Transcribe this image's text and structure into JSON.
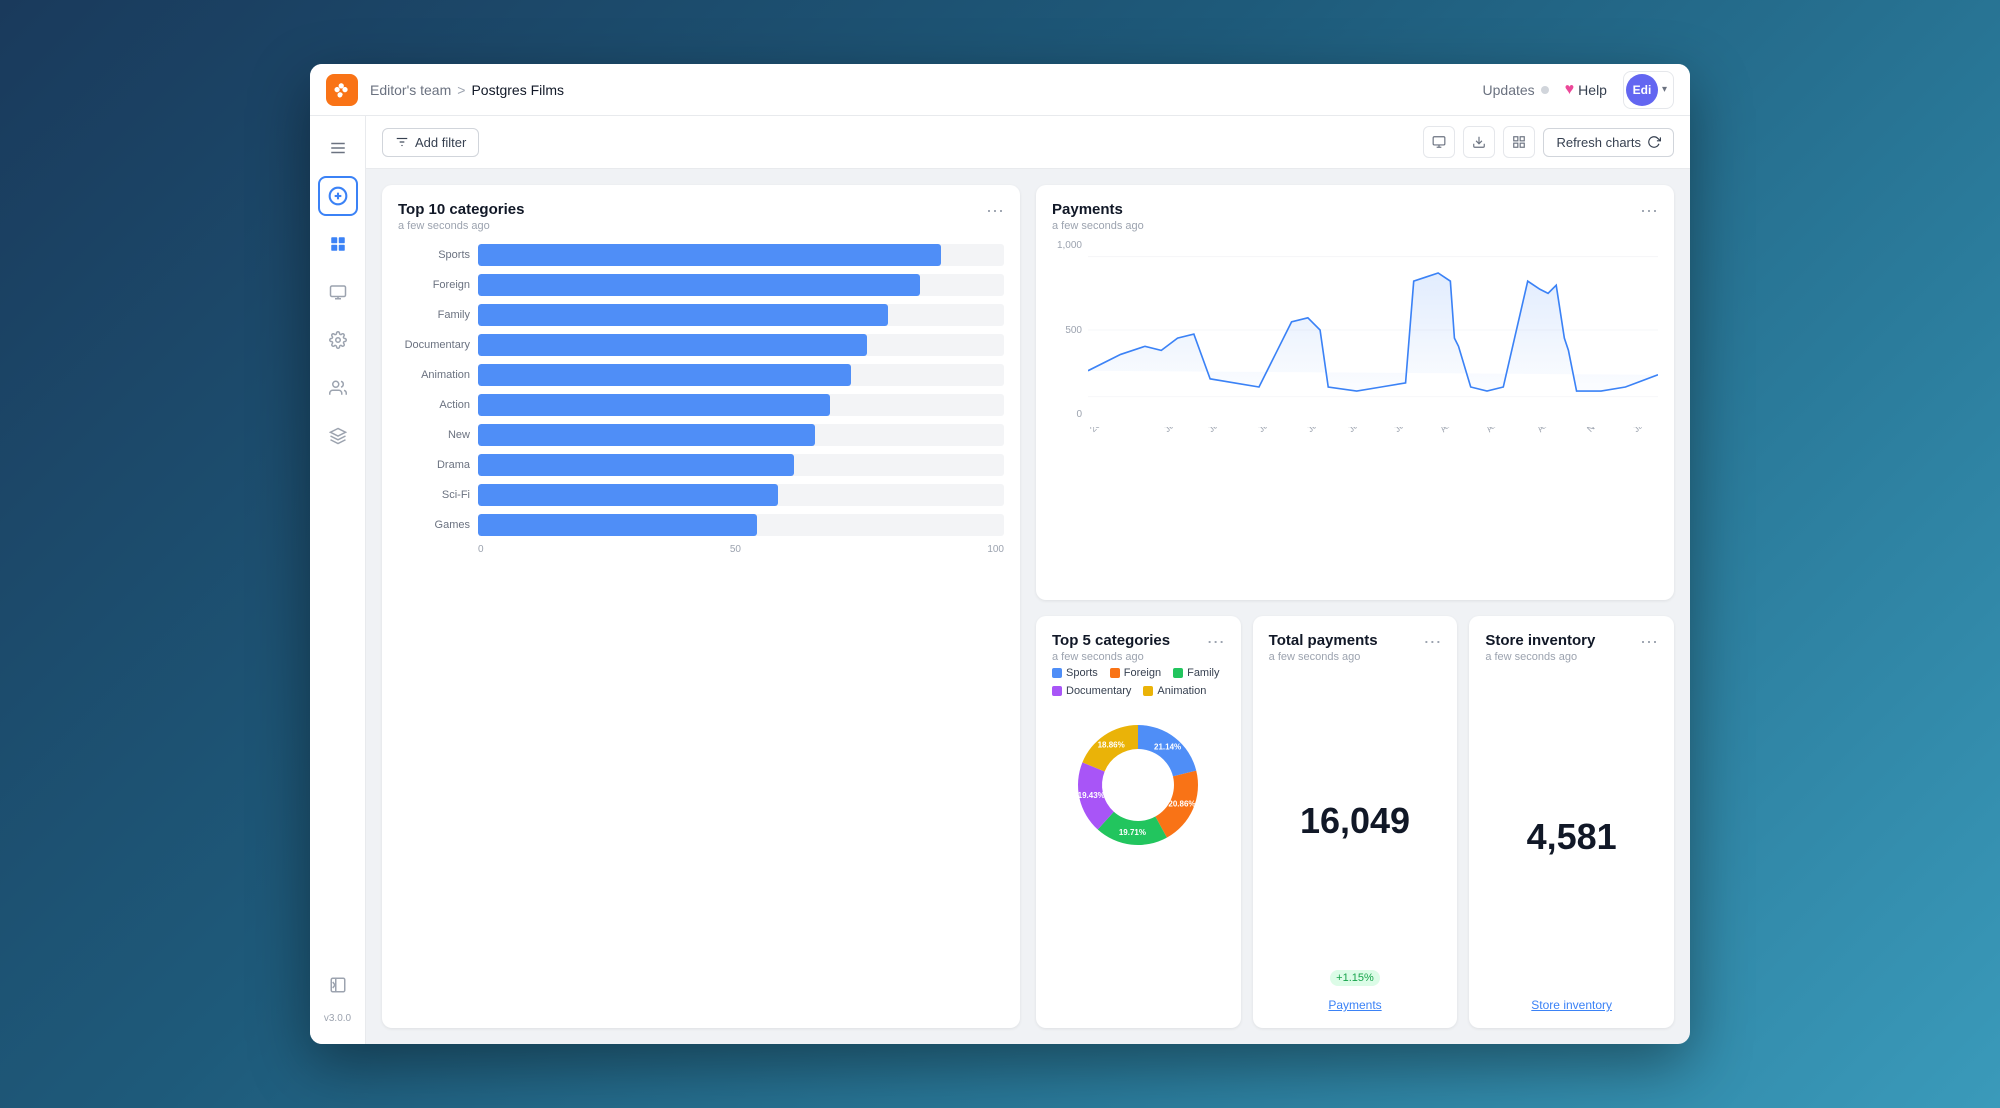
{
  "topbar": {
    "logo_icon": "🤚",
    "team": "Editor's team",
    "separator": ">",
    "project": "Postgres Films",
    "updates_label": "Updates",
    "help_label": "Help",
    "user_initials": "Edi",
    "user_chevron": "▾"
  },
  "toolbar": {
    "add_filter_label": "Add filter",
    "refresh_label": "Refresh charts"
  },
  "sidebar": {
    "version": "v3.0.0",
    "items": [
      {
        "id": "menu",
        "icon": "☰",
        "label": "Menu"
      },
      {
        "id": "add",
        "icon": "+",
        "label": "Add"
      },
      {
        "id": "dashboard",
        "icon": "⊞",
        "label": "Dashboard"
      },
      {
        "id": "display",
        "icon": "▭",
        "label": "Display"
      },
      {
        "id": "settings",
        "icon": "⚙",
        "label": "Settings"
      },
      {
        "id": "users",
        "icon": "👥",
        "label": "Users"
      },
      {
        "id": "integrations",
        "icon": "⊕",
        "label": "Integrations"
      },
      {
        "id": "collapse",
        "icon": "◧",
        "label": "Collapse"
      }
    ]
  },
  "top_categories_chart": {
    "title": "Top 10 categories",
    "subtitle": "a few seconds ago",
    "bars": [
      {
        "label": "Sports",
        "value": 100,
        "pct": 88
      },
      {
        "label": "Foreign",
        "value": 95,
        "pct": 84
      },
      {
        "label": "Family",
        "value": 88,
        "pct": 78
      },
      {
        "label": "Documentary",
        "value": 84,
        "pct": 74
      },
      {
        "label": "Animation",
        "value": 80,
        "pct": 71
      },
      {
        "label": "Action",
        "value": 76,
        "pct": 67
      },
      {
        "label": "New",
        "value": 72,
        "pct": 64
      },
      {
        "label": "Drama",
        "value": 68,
        "pct": 60
      },
      {
        "label": "Sci-Fi",
        "value": 64,
        "pct": 57
      },
      {
        "label": "Games",
        "value": 60,
        "pct": 53
      }
    ],
    "axis_labels": [
      "0",
      "50",
      "100"
    ]
  },
  "payments_chart": {
    "title": "Payments",
    "subtitle": "a few seconds ago",
    "y_labels": [
      "1,000",
      "500",
      "0"
    ],
    "x_labels": [
      "2005 May 24",
      "2005 Jun 3",
      "2005 Jun 13",
      "2005 Jun 23",
      "2005 Jul 3",
      "2005 Jul 13",
      "2005 Jul 23",
      "2005 Aug 2",
      "2005 Aug 12",
      "2005 Aug 22",
      "2005 Nov 3",
      "2006 Jan 22"
    ]
  },
  "top5_chart": {
    "title": "Top 5 categories",
    "subtitle": "a few seconds ago",
    "legend": [
      {
        "label": "Sports",
        "color": "#4f8ef7"
      },
      {
        "label": "Foreign",
        "color": "#f97316"
      },
      {
        "label": "Family",
        "color": "#22c55e"
      },
      {
        "label": "Documentary",
        "color": "#a855f7"
      },
      {
        "label": "Animation",
        "color": "#eab308"
      }
    ],
    "segments": [
      {
        "label": "21.14%",
        "value": 21.14,
        "color": "#4f8ef7"
      },
      {
        "label": "20.86%",
        "value": 20.86,
        "color": "#f97316"
      },
      {
        "label": "19.71%",
        "value": 19.71,
        "color": "#22c55e"
      },
      {
        "label": "19.43%",
        "value": 19.43,
        "color": "#a855f7"
      },
      {
        "label": "18.86%",
        "value": 18.86,
        "color": "#eab308"
      }
    ]
  },
  "total_payments": {
    "title": "Total payments",
    "subtitle": "a few seconds ago",
    "value": "16,049",
    "badge": "+1.15%",
    "link": "Payments"
  },
  "store_inventory": {
    "title": "Store inventory",
    "subtitle": "a few seconds ago",
    "value": "4,581",
    "link": "Store inventory"
  }
}
